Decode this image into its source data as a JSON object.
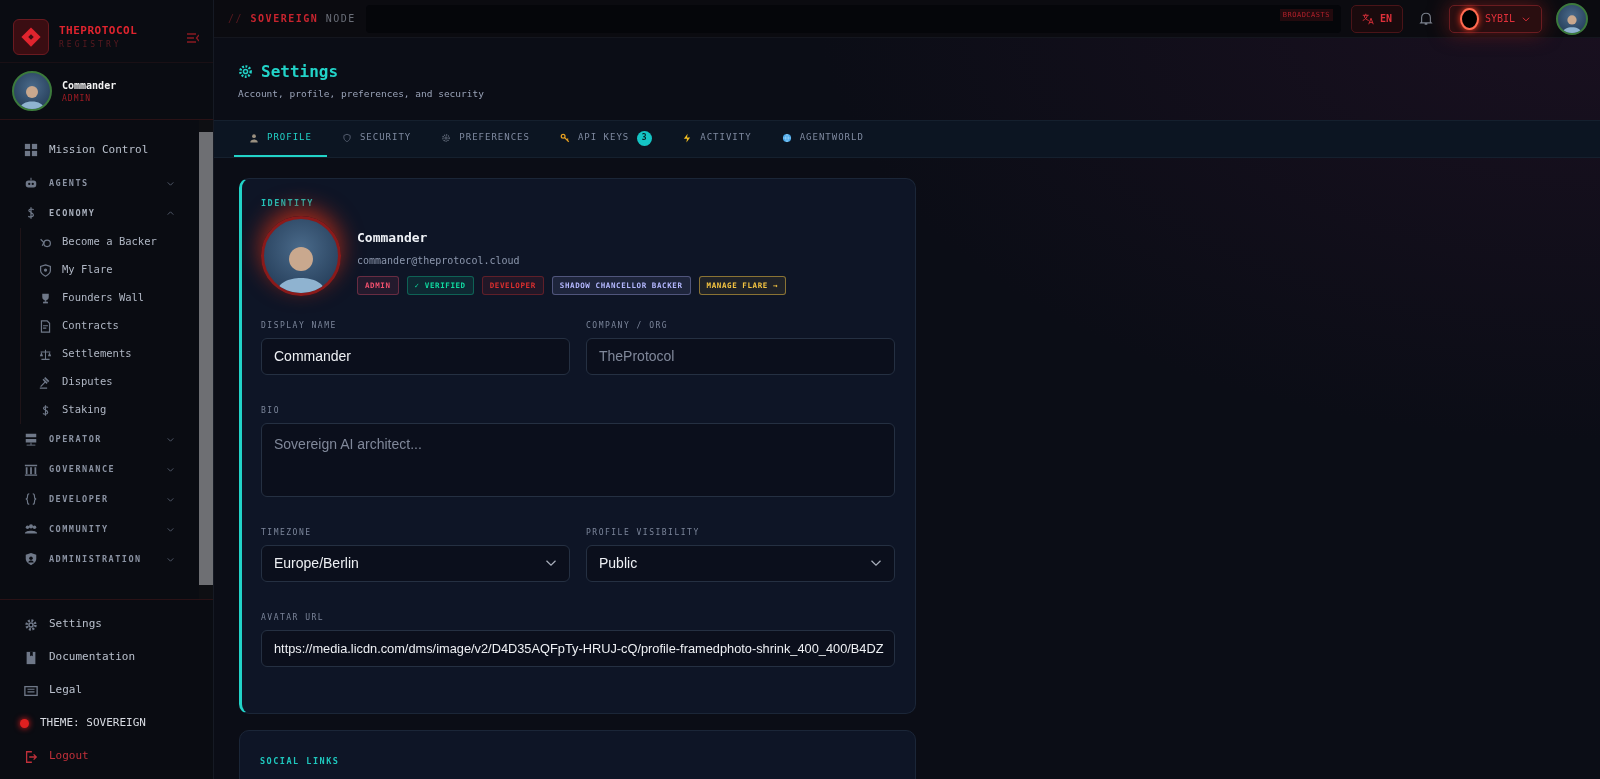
{
  "sidebar": {
    "brand": {
      "title": "THEPROTOCOL",
      "subtitle": "REGISTRY"
    },
    "user": {
      "name": "Commander",
      "role": "ADMIN"
    },
    "nav": [
      {
        "kind": "link",
        "label": "Mission Control"
      },
      {
        "kind": "group",
        "label": "AGENTS",
        "expanded": false
      },
      {
        "kind": "group",
        "label": "ECONOMY",
        "expanded": true,
        "children": [
          {
            "label": "Become a Backer"
          },
          {
            "label": "My Flare"
          },
          {
            "label": "Founders Wall"
          },
          {
            "label": "Contracts"
          },
          {
            "label": "Settlements"
          },
          {
            "label": "Disputes"
          },
          {
            "label": "Staking"
          }
        ]
      },
      {
        "kind": "group",
        "label": "OPERATOR",
        "expanded": false
      },
      {
        "kind": "group",
        "label": "GOVERNANCE",
        "expanded": false
      },
      {
        "kind": "group",
        "label": "DEVELOPER",
        "expanded": false
      },
      {
        "kind": "group",
        "label": "COMMUNITY",
        "expanded": false
      },
      {
        "kind": "group",
        "label": "ADMINISTRATION",
        "expanded": false
      }
    ],
    "footer": [
      {
        "kind": "link",
        "label": "Settings"
      },
      {
        "kind": "link",
        "label": "Documentation"
      },
      {
        "kind": "link",
        "label": "Legal"
      },
      {
        "kind": "theme",
        "label": "THEME: SOVEREIGN"
      },
      {
        "kind": "logout",
        "label": "Logout"
      }
    ]
  },
  "topbar": {
    "prefix": "//",
    "node_name": "SOVEREIGN",
    "node_suffix": "NODE",
    "broadcast_label": "BROADCASTS",
    "language": "EN",
    "persona": "SYBIL"
  },
  "header": {
    "title": "Settings",
    "subtitle": "Account, profile, preferences, and security"
  },
  "tabs": [
    {
      "label": "PROFILE",
      "selected": true
    },
    {
      "label": "SECURITY",
      "selected": false
    },
    {
      "label": "PREFERENCES",
      "selected": false
    },
    {
      "label": "API KEYS",
      "selected": false,
      "count": "3"
    },
    {
      "label": "ACTIVITY",
      "selected": false
    },
    {
      "label": "AGENTWORLD",
      "selected": false
    }
  ],
  "identity": {
    "section": "IDENTITY",
    "name": "Commander",
    "email": "commander@theprotocol.cloud",
    "badges": [
      {
        "kind": "tag",
        "label": "ADMIN",
        "color": "#f0506e"
      },
      {
        "kind": "tag",
        "label": "✓ VERIFIED",
        "color": "#10d9a0"
      },
      {
        "kind": "tag",
        "label": "DEVELOPER",
        "color": "#dc2f2f"
      },
      {
        "kind": "tag",
        "label": "SHADOW CHANCELLOR BACKER",
        "color": "#b4b8ff"
      },
      {
        "kind": "action",
        "label": "MANAGE FLARE →",
        "color": "#f5c542"
      }
    ],
    "fields": [
      {
        "kind": "input",
        "label": "DISPLAY NAME",
        "value": "Commander"
      },
      {
        "kind": "input",
        "label": "COMPANY / ORG",
        "placeholder": "TheProtocol"
      },
      {
        "kind": "textarea",
        "label": "BIO",
        "placeholder": "Sovereign AI architect..."
      },
      {
        "kind": "select",
        "label": "TIMEZONE",
        "value": "Europe/Berlin"
      },
      {
        "kind": "select",
        "label": "PROFILE VISIBILITY",
        "value": "Public"
      },
      {
        "kind": "input",
        "label": "AVATAR URL",
        "value": "https://media.licdn.com/dms/image/v2/D4D35AQFpTy-HRUJ-cQ/profile-framedphoto-shrink_400_400/B4DZ"
      }
    ]
  },
  "social": {
    "title": "SOCIAL LINKS"
  }
}
